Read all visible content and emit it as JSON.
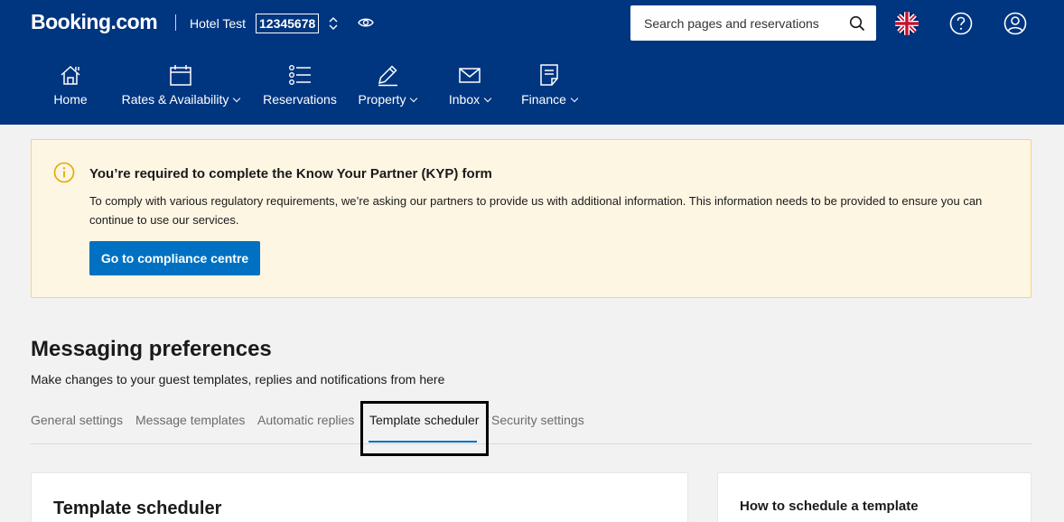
{
  "header": {
    "logo": "Booking.com",
    "hotel_name": "Hotel Test",
    "hotel_id": "12345678",
    "search": {
      "placeholder": "Search pages and reservations"
    },
    "icons": [
      "swap-icon",
      "eye-icon",
      "search-icon",
      "uk-flag-icon",
      "help-icon",
      "user-icon"
    ]
  },
  "nav": {
    "items": [
      {
        "label": "Home",
        "icon": "home-icon",
        "dropdown": false
      },
      {
        "label": "Rates & Availability",
        "icon": "calendar-icon",
        "dropdown": true
      },
      {
        "label": "Reservations",
        "icon": "list-icon",
        "dropdown": false
      },
      {
        "label": "Property",
        "icon": "pencil-icon",
        "dropdown": true
      },
      {
        "label": "Inbox",
        "icon": "envelope-icon",
        "dropdown": true
      },
      {
        "label": "Finance",
        "icon": "document-icon",
        "dropdown": true
      }
    ]
  },
  "alert": {
    "title": "You’re required to complete the Know Your Partner (KYP) form",
    "text": "To comply with various regulatory requirements, we’re asking our partners to provide us with additional information. This information needs to be provided to ensure you can continue to use our services.",
    "button_label": "Go to compliance centre"
  },
  "page": {
    "title": "Messaging preferences",
    "subtitle": "Make changes to your guest templates, replies and notifications from here"
  },
  "tabs": {
    "items": [
      {
        "label": "General settings"
      },
      {
        "label": "Message templates"
      },
      {
        "label": "Automatic replies"
      },
      {
        "label": "Template scheduler"
      },
      {
        "label": "Security settings"
      }
    ],
    "active_index": 3
  },
  "cards": {
    "main_title": "Template scheduler",
    "side_title": "How to schedule a template"
  },
  "colors": {
    "header_bg": "#003580",
    "accent": "#0071c2",
    "alert_bg": "#fdf6e3",
    "alert_border": "#f0d48b",
    "alert_icon": "#e5a800"
  }
}
